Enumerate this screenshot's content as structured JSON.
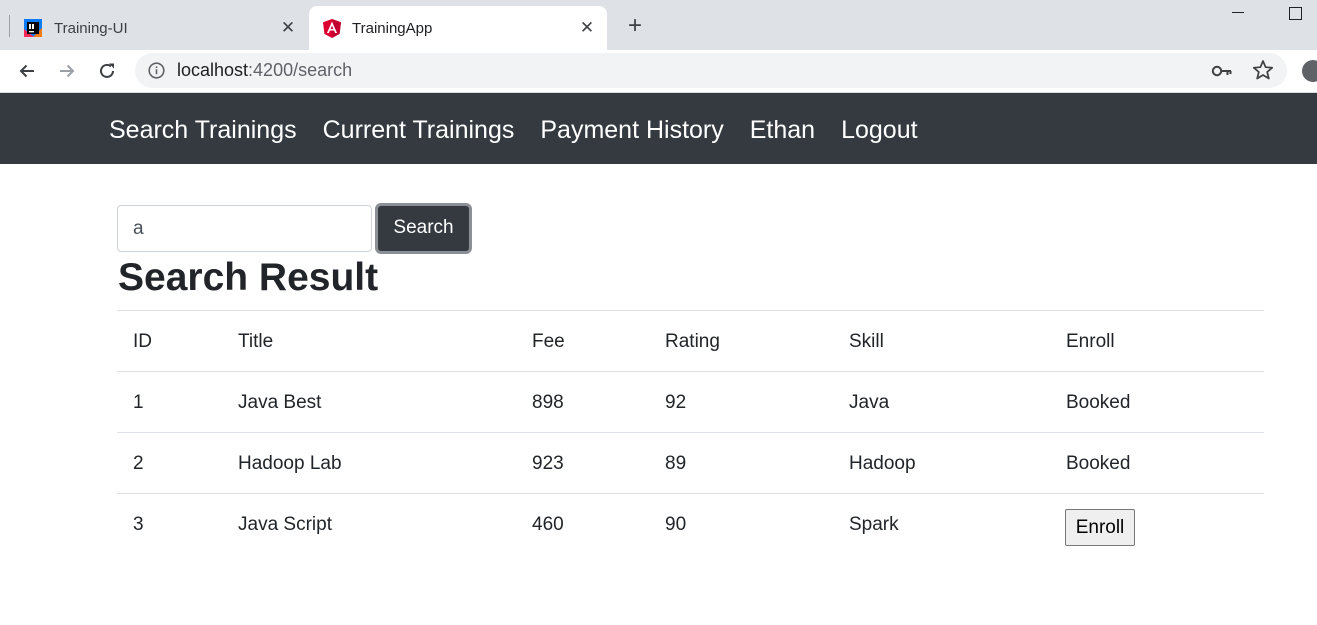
{
  "browser": {
    "tabs": [
      {
        "title": "Training-UI",
        "favicon": "intellij-icon",
        "close": "✕",
        "active": false
      },
      {
        "title": "TrainingApp",
        "favicon": "angular-icon",
        "close": "✕",
        "active": true
      }
    ],
    "new_tab": "+",
    "url_host": "localhost",
    "url_rest": ":4200/search"
  },
  "nav": {
    "items": [
      "Search Trainings",
      "Current Trainings",
      "Payment History",
      "Ethan",
      "Logout"
    ]
  },
  "search": {
    "value": "a",
    "button_label": "Search"
  },
  "results": {
    "title": "Search Result",
    "headers": [
      "ID",
      "Title",
      "Fee",
      "Rating",
      "Skill",
      "Enroll"
    ],
    "rows": [
      {
        "id": "1",
        "title": "Java Best",
        "fee": "898",
        "rating": "92",
        "skill": "Java",
        "enroll": "Booked"
      },
      {
        "id": "2",
        "title": "Hadoop Lab",
        "fee": "923",
        "rating": "89",
        "skill": "Hadoop",
        "enroll": "Booked"
      },
      {
        "id": "3",
        "title": "Java Script",
        "fee": "460",
        "rating": "90",
        "skill": "Spark",
        "enroll": "Enroll"
      }
    ]
  },
  "colors": {
    "navbar": "#343a40",
    "tabstrip": "#dee1e6",
    "angular_red": "#dd0031"
  }
}
